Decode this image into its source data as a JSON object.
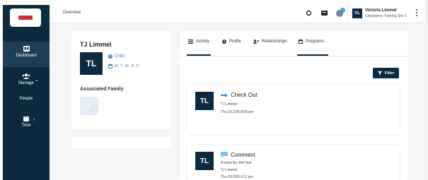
{
  "header": {
    "breadcrumb": "Overview",
    "user": {
      "initials": "VL",
      "name": "Victoria Limmel",
      "subtitle": "Champions Training Site 1"
    }
  },
  "sidebar": {
    "items": [
      {
        "label": "Dashboard",
        "icon": "dashboard-icon"
      },
      {
        "label": "Manage",
        "icon": "people-group-icon"
      },
      {
        "label": "People",
        "icon": ""
      },
      {
        "label": "Time",
        "icon": "calendar-icon"
      }
    ]
  },
  "profile": {
    "name": "TJ Limmel",
    "initials": "TL",
    "role": "Child",
    "days": "M T W R F",
    "associated_family_label": "Associated Family"
  },
  "tabs": [
    {
      "label": "Activity",
      "icon": "list-icon"
    },
    {
      "label": "Profile",
      "icon": "profile-icon"
    },
    {
      "label": "Relationships",
      "icon": "relationships-icon"
    },
    {
      "label": "Programs",
      "icon": "programs-icon"
    }
  ],
  "filter_label": "Filter",
  "feed": [
    {
      "initials": "TL",
      "title": "Check Out",
      "icon": "checkout-arrow-icon",
      "lines": [
        "TJ Limmel",
        "Thu 2/12/26 8:00 pm"
      ]
    },
    {
      "initials": "TL",
      "title": "Comment",
      "icon": "comment-icon",
      "lines": [
        "Posted By: AM Ops",
        "TJ Limmel",
        "Thu 2/12/26 6:11 pm"
      ]
    }
  ],
  "colors": {
    "sidebar": "#0e2a3f",
    "accent": "#0e2a3f",
    "link_blue": "#4a7fb0",
    "checkout_blue": "#2e8fd6",
    "notification_badge": "#3aa0e0",
    "logo_red": "#c8332d"
  }
}
